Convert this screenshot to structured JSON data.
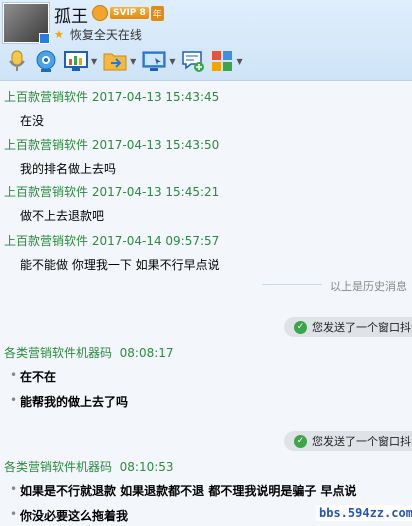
{
  "header": {
    "name": "孤王",
    "vip_badge": "SVIP 8",
    "vip_year": "年",
    "signature": "恢复全天在线"
  },
  "toolbar": {
    "icons": [
      "microphone-icon",
      "video-icon",
      "screen-share-icon",
      "file-transfer-icon",
      "remote-desktop-icon",
      "message-note-icon",
      "apps-icon"
    ]
  },
  "messages": [
    {
      "sender": "上百款营销软件",
      "time": "2017-04-13 15:43:45",
      "text": "在没"
    },
    {
      "sender": "上百款营销软件",
      "time": "2017-04-13 15:43:50",
      "text": "我的排名做上去吗"
    },
    {
      "sender": "上百款营销软件",
      "time": "2017-04-13 15:45:21",
      "text": "做不上去退款吧"
    },
    {
      "sender": "上百款营销软件",
      "time": "2017-04-14 09:57:57",
      "text": "能不能做 你理我一下   如果不行早点说"
    }
  ],
  "history_label": "以上是历史消息",
  "notice_1": "您发送了一个窗口抖动",
  "notice_2": "您发送了一个窗口抖动",
  "group_1": {
    "sender": "各类营销软件机器码",
    "time": "08:08:17",
    "lines": [
      "在不在",
      "能帮我的做上去了吗"
    ]
  },
  "group_2": {
    "sender": "各类营销软件机器码",
    "time": "08:10:53",
    "lines": [
      "如果是不行就退款   如果退款都不退   都不理我说明是骗子   早点说",
      "你没必要这么拖着我"
    ]
  },
  "watermark": "bbs.594zz.com"
}
